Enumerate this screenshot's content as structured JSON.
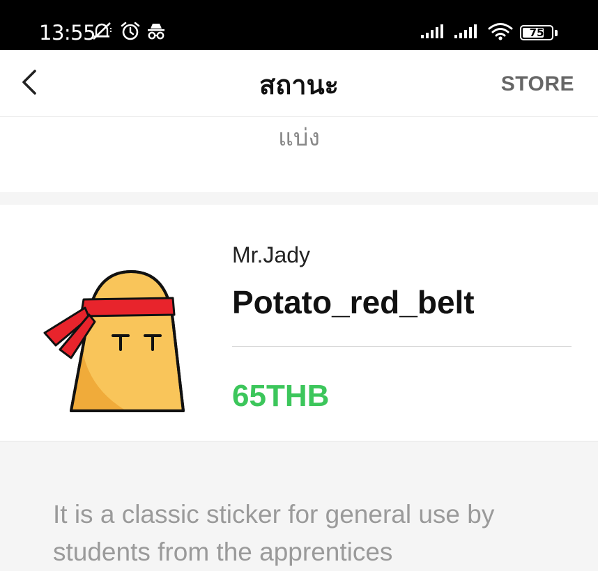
{
  "status_bar": {
    "time": "13:55",
    "battery": "75",
    "battery_fraction": 0.75,
    "icons_left": [
      "mute-icon",
      "alarm-icon",
      "incognito-icon"
    ],
    "icons_right": [
      "signal-icon",
      "signal-icon",
      "wifi-icon",
      "battery-icon"
    ]
  },
  "header": {
    "title": "สถานะ",
    "store_label": "STORE",
    "back_icon": "chevron-left-icon"
  },
  "share": {
    "label": "แบ่ง"
  },
  "product": {
    "author": "Mr.Jady",
    "name": "Potato_red_belt",
    "price": "65THB",
    "image_icon": "potato-sticker-icon",
    "price_color": "#3cc65b"
  },
  "description": {
    "text": "It is a classic sticker for general use by students from the apprentices"
  }
}
